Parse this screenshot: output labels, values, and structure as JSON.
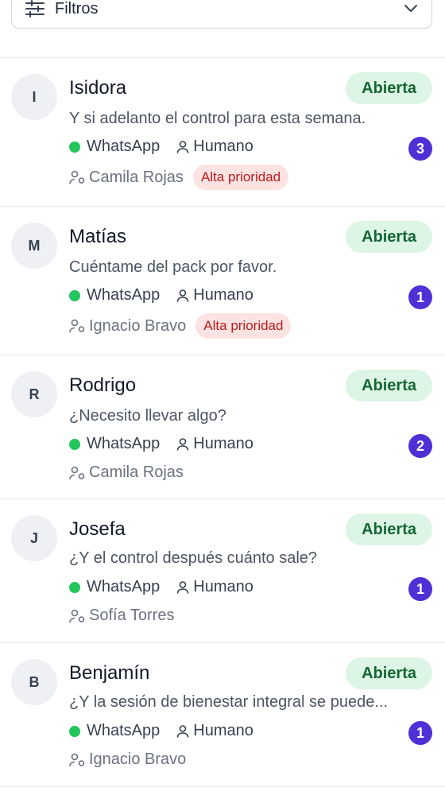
{
  "filters": {
    "label": "Filtros",
    "icon": "sliders-icon",
    "chevron": "chevron-down-icon"
  },
  "colors": {
    "status_bg": "#dcf5e4",
    "status_text": "#166534",
    "badge": "#4f2fd6",
    "channel_dot": "#22c55e",
    "priority_bg": "#fde2e2",
    "priority_text": "#b91c1c"
  },
  "conversations": [
    {
      "initial": "I",
      "name": "Isidora",
      "status": "Abierta",
      "message": "Y si adelanto el control para esta semana.",
      "channel": "WhatsApp",
      "mode": "Humano",
      "unread": "3",
      "agent": "Camila Rojas",
      "priority": "Alta prioridad"
    },
    {
      "initial": "M",
      "name": "Matías",
      "status": "Abierta",
      "message": "Cuéntame del pack por favor.",
      "channel": "WhatsApp",
      "mode": "Humano",
      "unread": "1",
      "agent": "Ignacio Bravo",
      "priority": "Alta prioridad"
    },
    {
      "initial": "R",
      "name": "Rodrigo",
      "status": "Abierta",
      "message": "¿Necesito llevar algo?",
      "channel": "WhatsApp",
      "mode": "Humano",
      "unread": "2",
      "agent": "Camila Rojas"
    },
    {
      "initial": "J",
      "name": "Josefa",
      "status": "Abierta",
      "message": "¿Y el control después cuánto sale?",
      "channel": "WhatsApp",
      "mode": "Humano",
      "unread": "1",
      "agent": "Sofía Torres"
    },
    {
      "initial": "B",
      "name": "Benjamín",
      "status": "Abierta",
      "message": "¿Y la sesión de bienestar integral se puede...",
      "channel": "WhatsApp",
      "mode": "Humano",
      "unread": "1",
      "agent": "Ignacio Bravo"
    }
  ]
}
